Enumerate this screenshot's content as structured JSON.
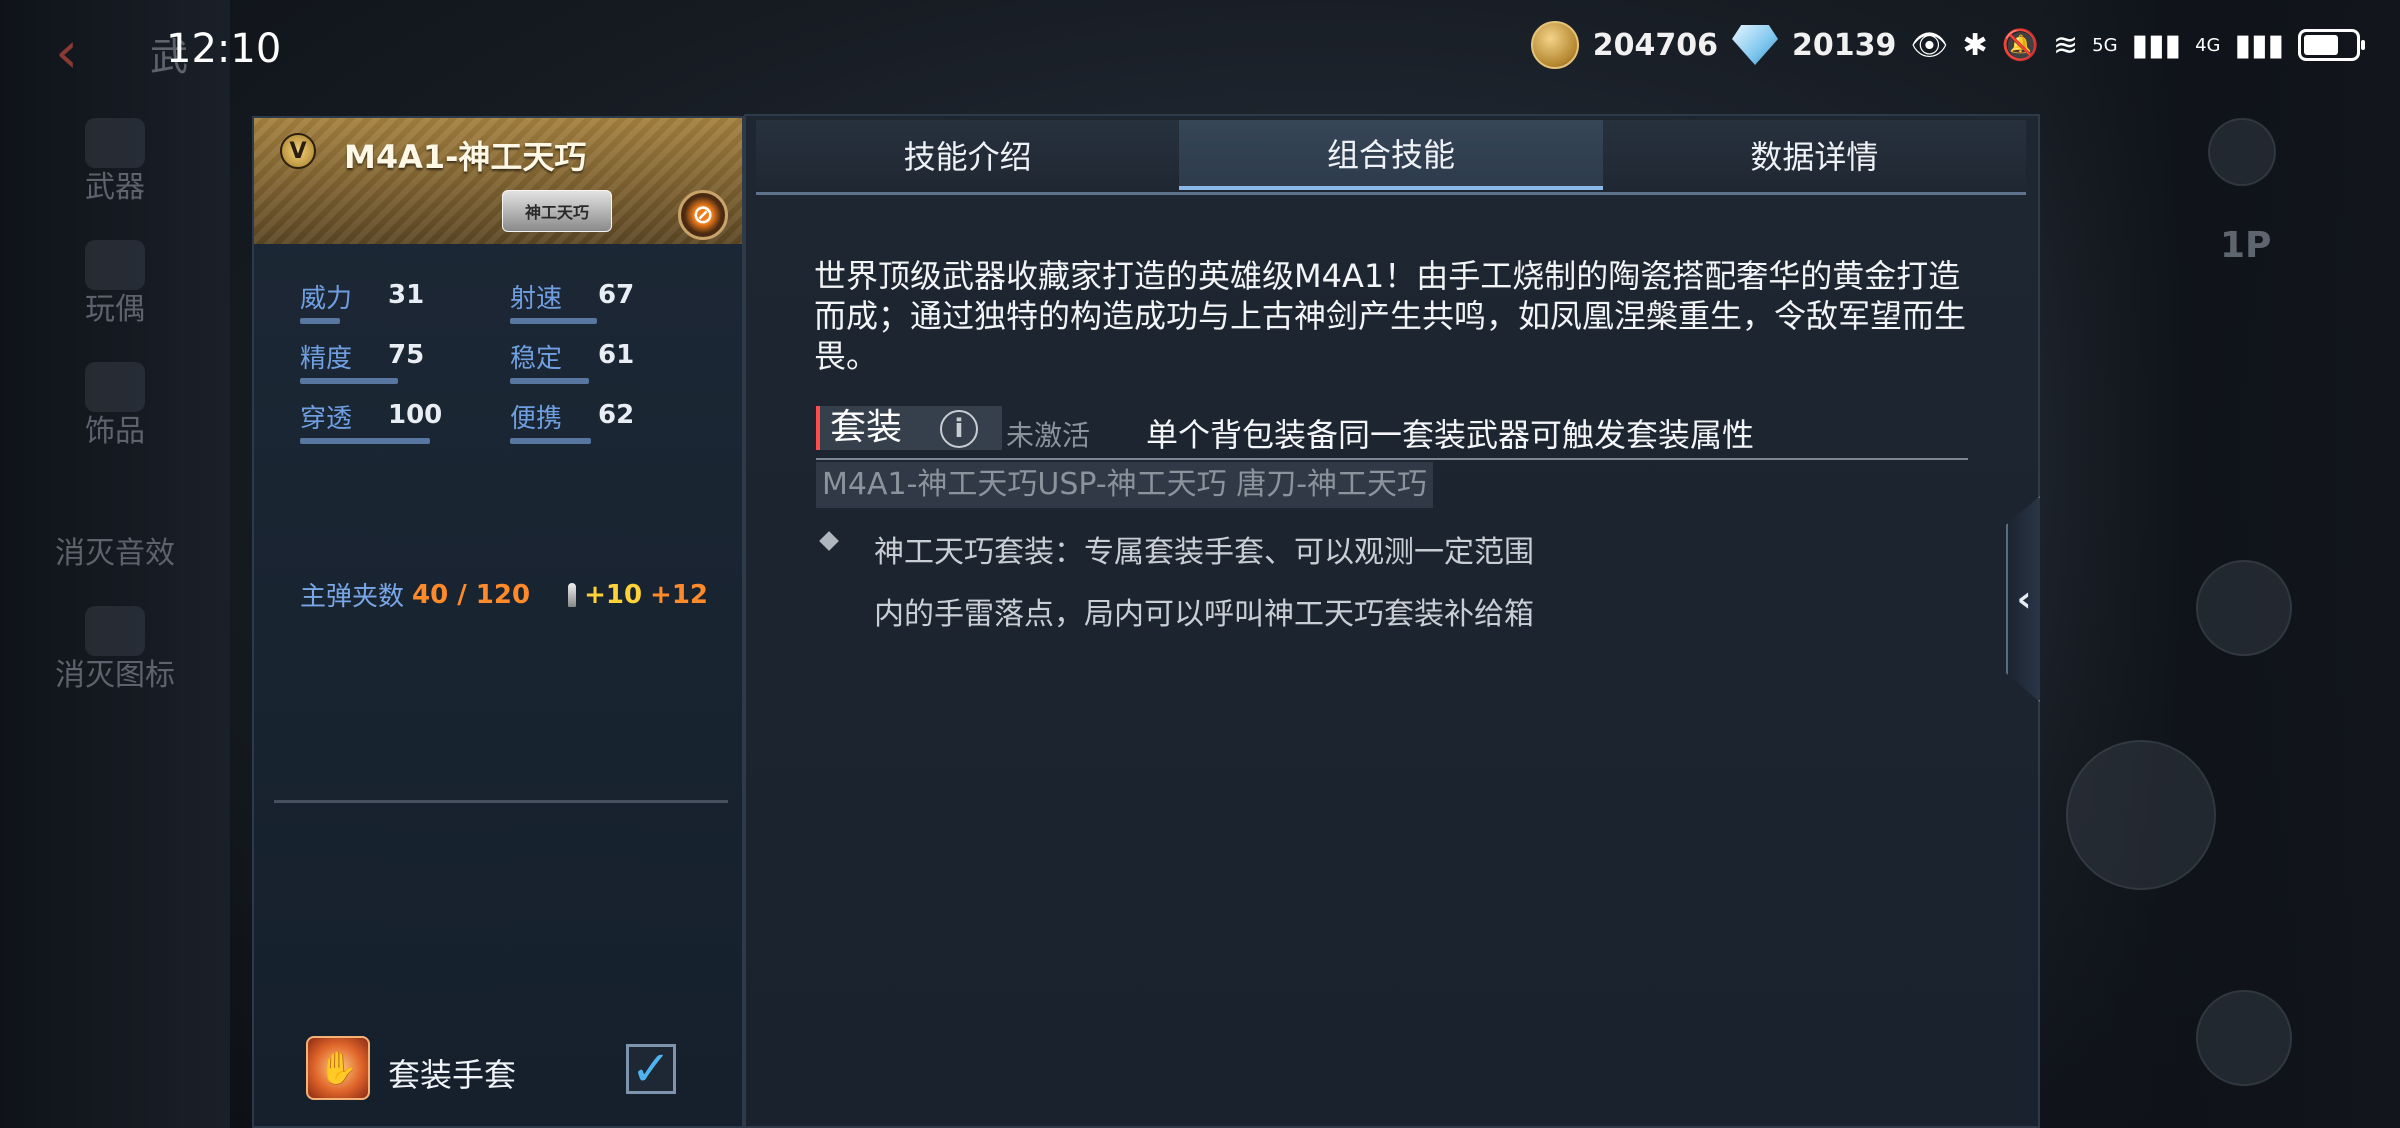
{
  "status_bar": {
    "time": "12:10",
    "coins": "204706",
    "diamonds": "20139",
    "network_5g": "5G",
    "network_4g": "4G"
  },
  "background_nav": {
    "back_label": "武",
    "items": [
      "武器",
      "玩偶",
      "饰品",
      "消灭音效",
      "消灭图标"
    ],
    "view_label": "1P"
  },
  "weapon_card": {
    "title": "M4A1-神工天巧",
    "rank_letter": "V",
    "skin_tag": "神工天巧",
    "stats": [
      {
        "label": "威力",
        "value": "31",
        "fill": 0.31
      },
      {
        "label": "射速",
        "value": "67",
        "fill": 0.67
      },
      {
        "label": "精度",
        "value": "75",
        "fill": 0.75
      },
      {
        "label": "稳定",
        "value": "61",
        "fill": 0.61
      },
      {
        "label": "穿透",
        "value": "100",
        "fill": 1.0
      },
      {
        "label": "便携",
        "value": "62",
        "fill": 0.62
      }
    ],
    "ammo_label": "主弹夹数",
    "ammo_value": "40 / 120",
    "ammo_bonus_1": "+10",
    "ammo_bonus_2": "+12",
    "glove_label": "套装手套",
    "glove_checked": true
  },
  "tabs": [
    {
      "label": "技能介绍",
      "active": false
    },
    {
      "label": "组合技能",
      "active": true
    },
    {
      "label": "数据详情",
      "active": false
    }
  ],
  "combo": {
    "description": "世界顶级武器收藏家打造的英雄级M4A1！由手工烧制的陶瓷搭配奢华的黄金打造而成；通过独特的构造成功与上古神剑产生共鸣，如凤凰涅槃重生，令敌军望而生畏。",
    "suit_name": "套装",
    "suit_status": "未激活",
    "suit_rule": "单个背包装备同一套装武器可触发套装属性",
    "suit_members": "M4A1-神工天巧USP-神工天巧 唐刀-神工天巧",
    "effect": "神工天巧套装：专属套装手套、可以观测一定范围内的手雷落点，局内可以呼叫神工天巧套装补给箱"
  },
  "colors": {
    "accent": "#8ab8e8",
    "stat_label": "#6f9fe0",
    "ammo_orange": "#ff8a2a",
    "ammo_yellow": "#ffd23a",
    "header_gold": "#a5813f"
  }
}
